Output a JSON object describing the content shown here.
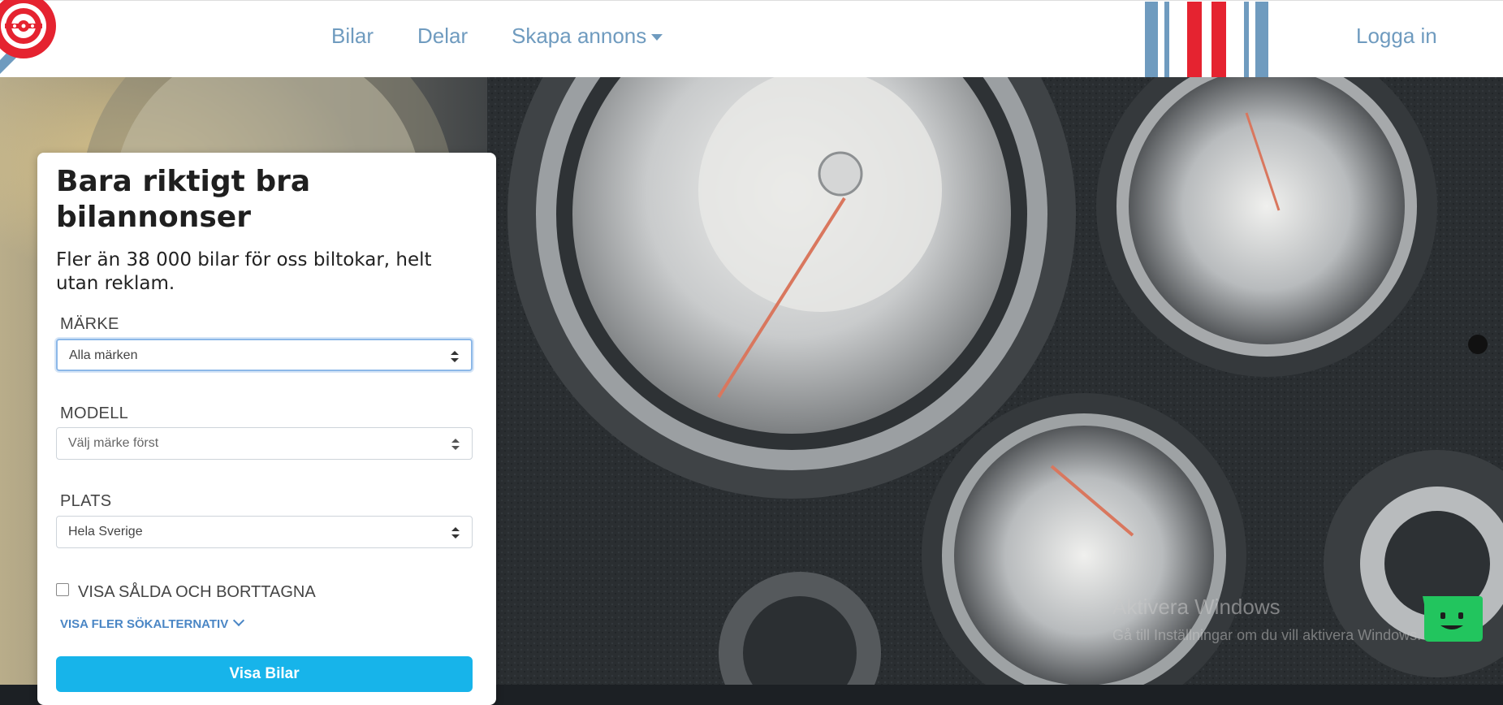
{
  "header": {
    "nav": [
      {
        "label": "Bilar"
      },
      {
        "label": "Delar"
      },
      {
        "label": "Skapa annons"
      }
    ],
    "login_label": "Logga in",
    "stripe_colors": [
      "#6f9bbf",
      "#ffffff",
      "#e52330"
    ]
  },
  "search": {
    "title": "Bara riktigt bra bilannonser",
    "subtitle": "Fler än 38 000 bilar för oss biltokar, helt utan reklam.",
    "brand": {
      "label": "MÄRKE",
      "value": "Alla märken"
    },
    "model": {
      "label": "MODELL",
      "value": "Välj märke först"
    },
    "location": {
      "label": "PLATS",
      "value": "Hela Sverige"
    },
    "show_sold_label": "VISA SÅLDA OCH BORTTAGNA",
    "show_sold_checked": false,
    "more_options_label": "VISA FLER SÖKALTERNATIV",
    "submit_label": "Visa Bilar"
  },
  "windows_watermark": {
    "title": "Aktivera Windows",
    "text": "Gå till Inställningar om du vill aktivera Windows."
  },
  "colors": {
    "nav": "#6f9bbf",
    "primary_button": "#17b4ea",
    "logo_red": "#e52330",
    "chat_widget": "#22c55e"
  }
}
